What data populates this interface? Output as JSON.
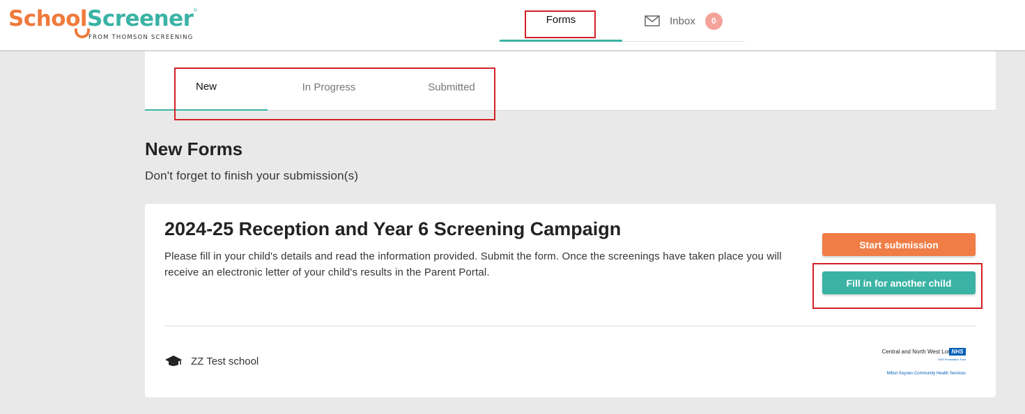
{
  "logo": {
    "name_part1": "School",
    "name_part2": "Screener",
    "registered": "®",
    "tagline": "FROM THOMSON SCREENING"
  },
  "nav": {
    "forms_label": "Forms",
    "inbox_label": "Inbox",
    "inbox_count": "0"
  },
  "tabs": [
    {
      "label": "New",
      "active": true
    },
    {
      "label": "In Progress",
      "active": false
    },
    {
      "label": "Submitted",
      "active": false
    }
  ],
  "page": {
    "title": "New Forms",
    "subtitle": "Don't forget to finish your submission(s)"
  },
  "campaign": {
    "title": "2024-25 Reception and Year 6 Screening Campaign",
    "description": "Please fill in your child's details and read the information provided. Submit the form. Once the screenings have taken place you will receive an electronic letter of your child's results in the Parent Portal.",
    "start_button": "Start submission",
    "fill_button": "Fill in for another child",
    "school_name": "ZZ Test school",
    "provider_line1": "Central and North West London",
    "provider_badge": "NHS",
    "provider_line2": "NHS Foundation Trust",
    "provider_line3": "Milton Keynes Community Health Services"
  },
  "colors": {
    "brand_orange": "#ef7a3c",
    "brand_teal": "#3ab3a5",
    "highlight_red": "#d31f26",
    "badge_pink": "#f4a39a",
    "nhs_blue": "#005eb8"
  }
}
